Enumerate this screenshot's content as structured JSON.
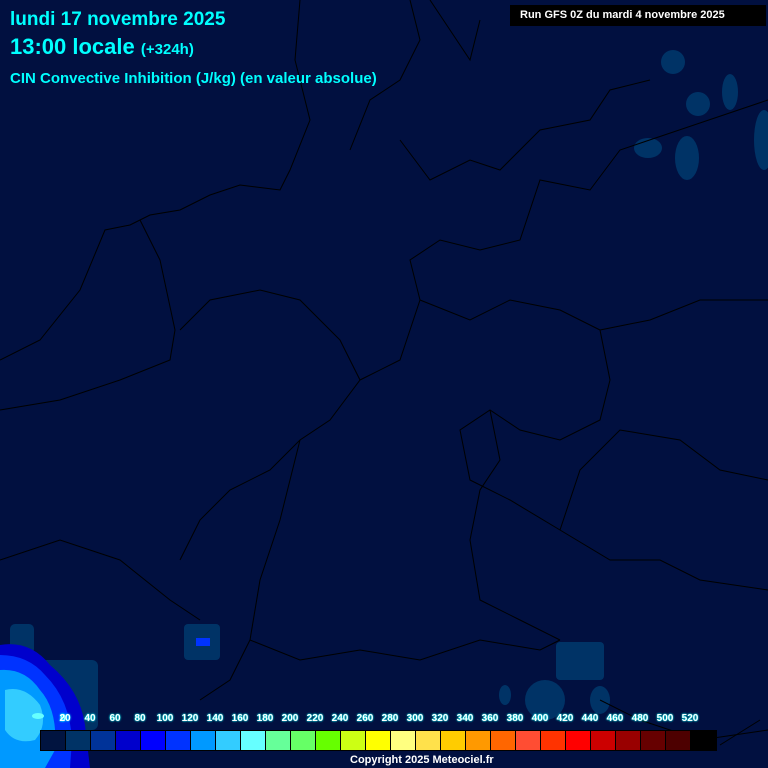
{
  "header": {
    "date": "lundi 17 novembre 2025",
    "time": "13:00 locale",
    "offset": "(+324h)",
    "parameter": "CIN Convective Inhibition (J/kg) (en valeur absolue)",
    "run": "Run GFS 0Z du mardi 4 novembre 2025"
  },
  "legend": {
    "labels": [
      "0",
      "20",
      "40",
      "60",
      "80",
      "100",
      "120",
      "140",
      "160",
      "180",
      "200",
      "220",
      "240",
      "260",
      "280",
      "300",
      "320",
      "340",
      "360",
      "380",
      "400",
      "420",
      "440",
      "460",
      "480",
      "500",
      "520"
    ],
    "colors": [
      "#011440",
      "#003366",
      "#003399",
      "#0000cc",
      "#0000ff",
      "#0033ff",
      "#0099ff",
      "#33ccff",
      "#66ffff",
      "#66ff99",
      "#66ff66",
      "#66ff00",
      "#ccff14",
      "#ffff00",
      "#ffff80",
      "#ffe14b",
      "#ffcc00",
      "#ff9900",
      "#ff6600",
      "#ff4d33",
      "#ff3300",
      "#ff0000",
      "#cc0000",
      "#990000",
      "#660000",
      "#4d0000",
      "#000000"
    ]
  },
  "footer": {
    "copyright": "Copyright 2025 Meteociel.fr"
  }
}
